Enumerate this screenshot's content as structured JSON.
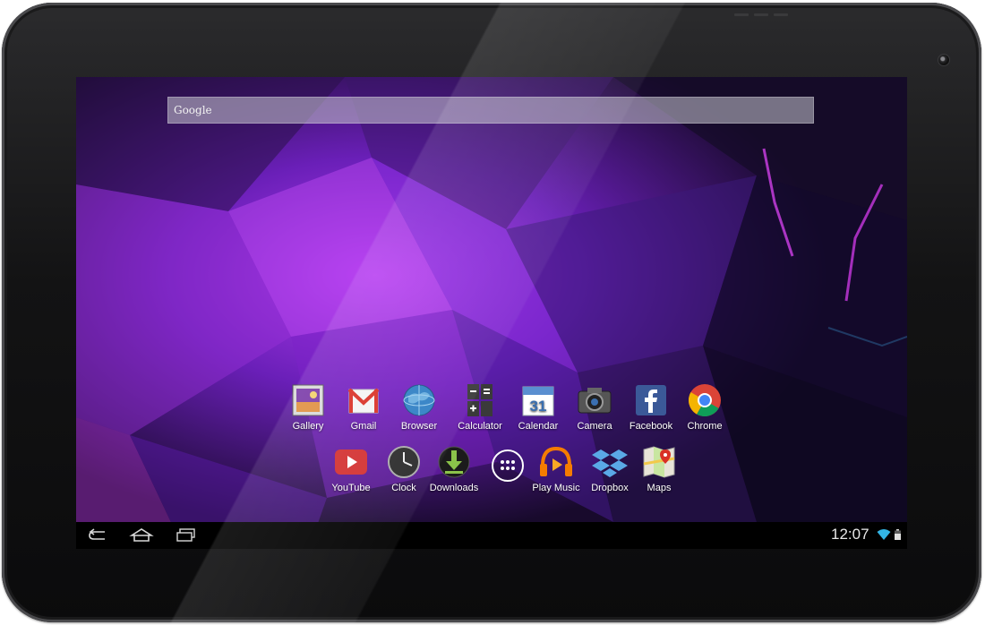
{
  "search": {
    "label": "Google"
  },
  "apps_row1": [
    {
      "label": "Gallery",
      "icon": "gallery-icon"
    },
    {
      "label": "Gmail",
      "icon": "gmail-icon"
    },
    {
      "label": "Browser",
      "icon": "browser-icon"
    },
    {
      "label": "Calculator",
      "icon": "calculator-icon"
    },
    {
      "label": "Calendar",
      "icon": "calendar-icon",
      "badge": "31"
    },
    {
      "label": "Camera",
      "icon": "camera-icon"
    },
    {
      "label": "Facebook",
      "icon": "facebook-icon"
    },
    {
      "label": "Chrome",
      "icon": "chrome-icon"
    }
  ],
  "apps_row2": [
    {
      "label": "YouTube",
      "icon": "youtube-icon"
    },
    {
      "label": "Clock",
      "icon": "clock-icon"
    },
    {
      "label": "Downloads",
      "icon": "downloads-icon"
    },
    {
      "label": "",
      "icon": "all-apps-icon"
    },
    {
      "label": "Play Music",
      "icon": "play-music-icon"
    },
    {
      "label": "Dropbox",
      "icon": "dropbox-icon"
    },
    {
      "label": "Maps",
      "icon": "maps-icon"
    }
  ],
  "status_bar": {
    "time": "12:07"
  },
  "colors": {
    "accent": "#33b5e5",
    "wallpaper": "#7a2ad0",
    "bezel": "#141415"
  }
}
